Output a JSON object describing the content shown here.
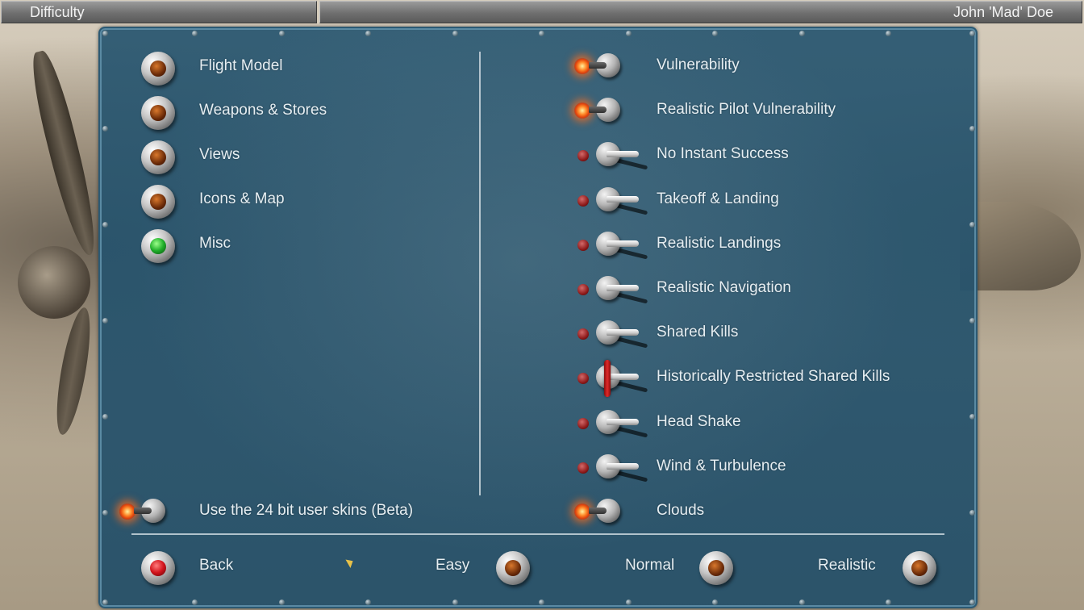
{
  "header": {
    "title": "Difficulty",
    "player": "John 'Mad' Doe"
  },
  "categories": [
    {
      "label": "Flight Model",
      "lamp": "amber"
    },
    {
      "label": "Weapons & Stores",
      "lamp": "amber"
    },
    {
      "label": "Views",
      "lamp": "amber"
    },
    {
      "label": "Icons & Map",
      "lamp": "amber"
    },
    {
      "label": "Misc",
      "lamp": "green",
      "selected": true
    }
  ],
  "options": [
    {
      "label": "Vulnerability",
      "on": true
    },
    {
      "label": "Realistic Pilot Vulnerability",
      "on": true
    },
    {
      "label": "No Instant Success",
      "on": false
    },
    {
      "label": "Takeoff & Landing",
      "on": false
    },
    {
      "label": "Realistic Landings",
      "on": false
    },
    {
      "label": "Realistic Navigation",
      "on": false
    },
    {
      "label": "Shared Kills",
      "on": false
    },
    {
      "label": "Historically Restricted Shared Kills",
      "on": false,
      "locked": true
    },
    {
      "label": "Head Shake",
      "on": false
    },
    {
      "label": "Wind & Turbulence",
      "on": false
    },
    {
      "label": "Clouds",
      "on": true
    }
  ],
  "skins": {
    "label": "Use the 24 bit user skins (Beta)",
    "on": true
  },
  "footer": {
    "back": "Back",
    "presets": [
      {
        "label": "Easy"
      },
      {
        "label": "Normal"
      },
      {
        "label": "Realistic"
      }
    ]
  },
  "colors": {
    "panel": "#2b5a77",
    "text": "#e6eef2",
    "led_on": "#ff6a1a",
    "select_green": "#1fae2a",
    "back_red": "#d2141c"
  }
}
